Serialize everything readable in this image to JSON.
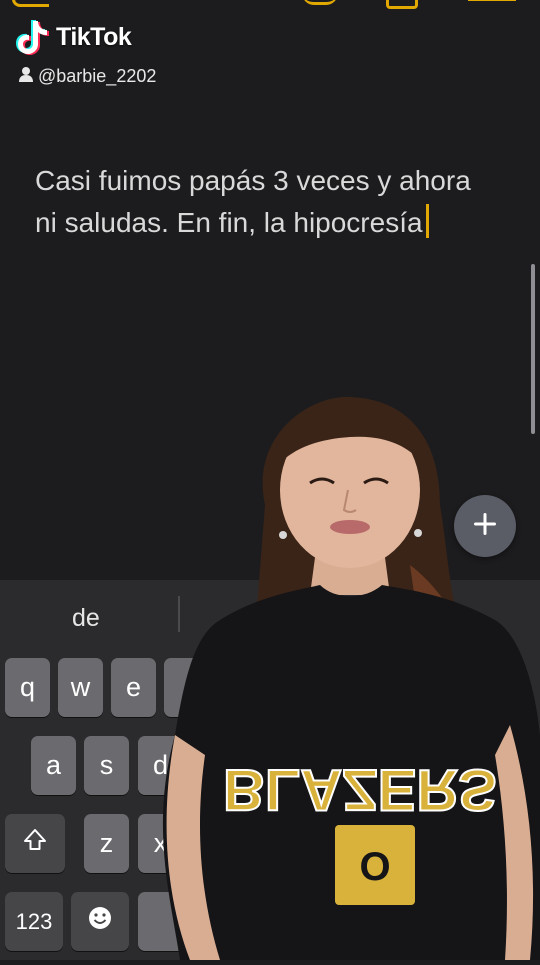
{
  "watermark": {
    "app": "TikTok",
    "username": "@barbie_2202"
  },
  "note": {
    "text": "Casi fuimos papás 3 veces y ahora ni saludas. En fin, la hipocresía"
  },
  "keyboard": {
    "suggestions": [
      "de"
    ],
    "row1": [
      "q",
      "w",
      "e"
    ],
    "row2": [
      "a",
      "s",
      "d"
    ],
    "row3": [
      "z",
      "x"
    ],
    "numbers_label": "123"
  },
  "shirt_text": "BLAZERS",
  "colors": {
    "accent": "#e0a800",
    "background": "#1c1c1e",
    "key": "#6b6b6f"
  }
}
